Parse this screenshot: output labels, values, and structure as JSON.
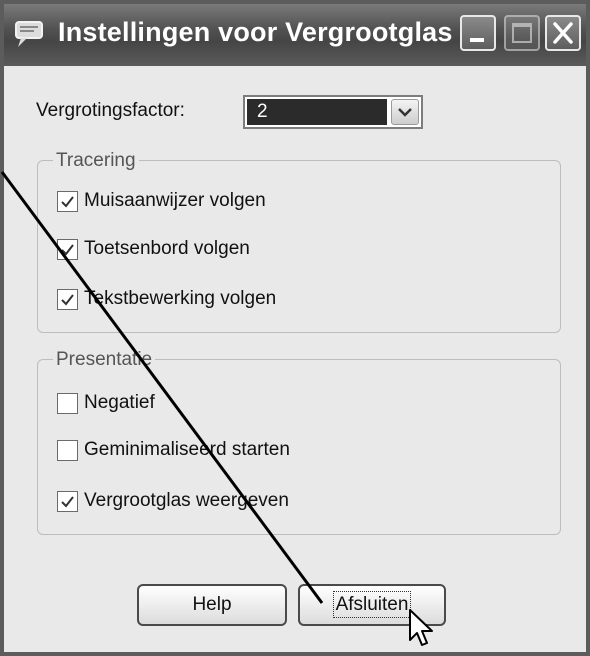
{
  "window": {
    "title": "Instellingen voor Vergrootglas"
  },
  "magnification": {
    "label": "Vergrotingsfactor:",
    "value": "2"
  },
  "tracking": {
    "legend": "Tracering",
    "items": [
      {
        "label": "Muisaanwijzer volgen",
        "checked": true
      },
      {
        "label": "Toetsenbord volgen",
        "checked": true
      },
      {
        "label": "Tekstbewerking volgen",
        "checked": true
      }
    ]
  },
  "presentation": {
    "legend": "Presentatie",
    "items": [
      {
        "label": "Negatief",
        "checked": false
      },
      {
        "label": "Geminimaliseerd starten",
        "checked": false
      },
      {
        "label": "Vergrootglas weergeven",
        "checked": true
      }
    ]
  },
  "buttons": {
    "help": "Help",
    "close": "Afsluiten"
  },
  "icons": {
    "app": "magnifier-app-icon",
    "minimize": "minimize-icon",
    "maximize": "maximize-icon",
    "close": "close-icon",
    "dropdown": "chevron-down-icon",
    "check": "checkmark-icon",
    "cursor": "mouse-pointer-icon"
  },
  "colors": {
    "titlebar": "#525252",
    "dialog": "#e9e9e9",
    "selection": "#2b2b2b"
  }
}
